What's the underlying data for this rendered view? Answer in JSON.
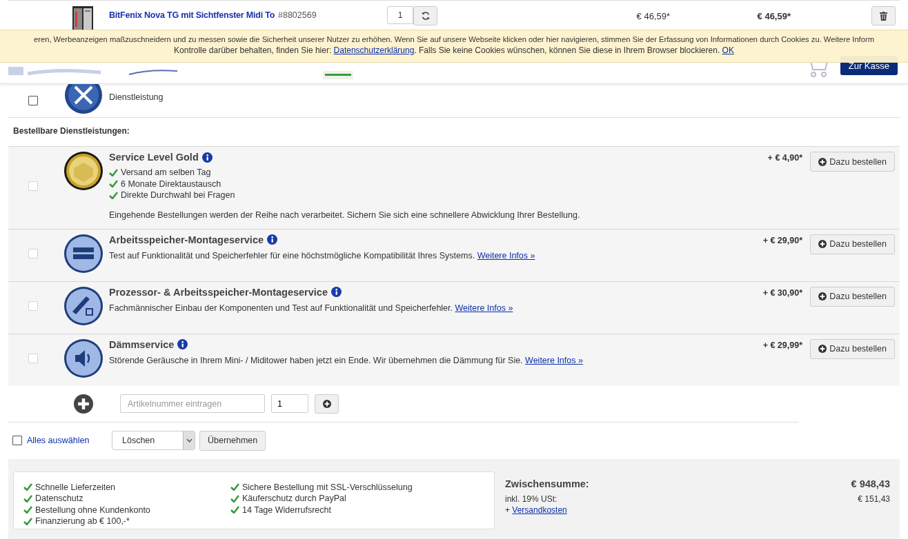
{
  "cart_item": {
    "title": "BitFenix Nova TG mit Sichtfenster Midi To",
    "article_no": "#8802569",
    "quantity": "1",
    "unit_price": "€ 46,59*",
    "total_price": "€ 46,59*"
  },
  "cookie_banner": {
    "line_1": "eren, Werbeanzeigen maßzuschneidern und zu messen sowie die Sicherheit unserer Nutzer zu erhöhen. Wenn Sie auf unsere Webseite klicken oder hier navigieren, stimmen Sie der Erfassung von Informationen durch Cookies zu. Weitere Inform",
    "line_2": [
      {
        "kind": "text",
        "text": "Kontrolle darüber behalten, finden Sie hier: "
      },
      {
        "kind": "link",
        "text": "Datenschutzerklärung"
      },
      {
        "kind": "text",
        "text": ". Falls Sie keine Cookies wünschen, können Sie diese in Ihrem Browser blockieren. "
      },
      {
        "kind": "link",
        "text": "OK"
      }
    ]
  },
  "header": {
    "checkout_button": "Zur Kasse"
  },
  "partial_item": {
    "checked": false,
    "subtitle": "Dienstleistung"
  },
  "services_heading": "Bestellbare Dienstleistungen:",
  "services": [
    {
      "kind": "gold",
      "checked": false,
      "disabled": true,
      "title": "Service Level Gold",
      "features": [
        "Versand am selben Tag",
        "6 Monate Direktaustausch",
        "Direkte Durchwahl bei Fragen"
      ],
      "description": "Eingehende Bestellungen werden der Reihe nach verarbeitet. Sichern Sie sich eine schnellere Abwicklung Ihrer Bestellung.",
      "price": "+ € 4,90*",
      "button": "Dazu bestellen"
    },
    {
      "kind": "ram",
      "checked": false,
      "disabled": true,
      "title": "Arbeitsspeicher-Montageservice",
      "description": "Test auf Funktionalität und Speicherfehler für eine höchstmögliche Kompatibilität Ihres Systems.",
      "link": "Weitere Infos »",
      "price": "+ € 29,90*",
      "button": "Dazu bestellen"
    },
    {
      "kind": "cpu-ram",
      "checked": false,
      "disabled": true,
      "title": "Prozessor- & Arbeitsspeicher-Montageservice",
      "description": "Fachmännischer Einbau der Komponenten und Test auf Funktionalität und Speicherfehler.",
      "link": "Weitere Infos »",
      "price": "+ € 30,90*",
      "button": "Dazu bestellen"
    },
    {
      "kind": "speaker",
      "checked": false,
      "disabled": true,
      "title": "Dämmservice",
      "description": "Störende Geräusche in Ihrem Mini- / Miditower haben jetzt ein Ende. Wir übernehmen die Dämmung für Sie.",
      "link": "Weitere Infos »",
      "price": "+ € 29,99*",
      "button": "Dazu bestellen"
    }
  ],
  "add_row": {
    "placeholder": "Artikelnummer eintragen",
    "quantity": "1"
  },
  "bulk": {
    "checked": false,
    "select_all": "Alles auswählen",
    "action": "Löschen",
    "apply_button": "Übernehmen"
  },
  "benefits": {
    "column_1": [
      "Schnelle Lieferzeiten",
      "Datenschutz",
      "Bestellung ohne Kundenkonto",
      "Finanzierung ab € 100,-*"
    ],
    "column_2": [
      "Sichere Bestellung mit SSL-Verschlüsselung",
      "Käuferschutz durch PayPal",
      "14 Tage Widerrufsrecht"
    ]
  },
  "summary": {
    "subtotal_label": "Zwischensumme:",
    "subtotal": "€ 948,43",
    "tax_label": "inkl. 19% USt:",
    "tax": "€ 151,43",
    "shipping_prefix": "+ ",
    "shipping_link": "Versandkosten"
  }
}
